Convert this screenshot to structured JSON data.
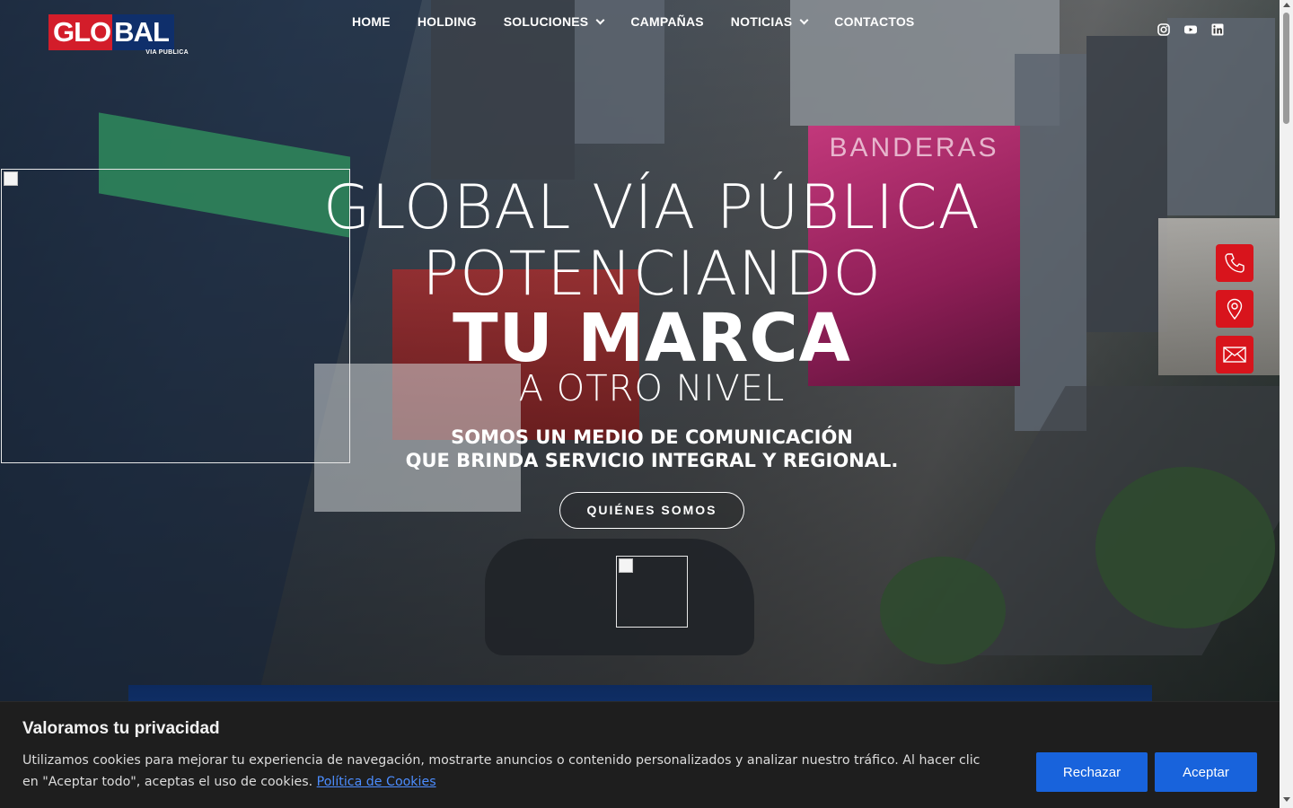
{
  "brand": {
    "logo_main_left": "GLO",
    "logo_main_right": "BAL",
    "logo_sub": "VIA PUBLICA",
    "colors": {
      "red": "#d31d2a",
      "navy": "#0f2f6b",
      "cookie_button": "#1863dc"
    }
  },
  "nav": {
    "items": [
      {
        "label": "HOME",
        "has_dropdown": false
      },
      {
        "label": "HOLDING",
        "has_dropdown": false
      },
      {
        "label": "SOLUCIONES",
        "has_dropdown": true
      },
      {
        "label": "CAMPAÑAS",
        "has_dropdown": false
      },
      {
        "label": "NOTICIAS",
        "has_dropdown": true
      },
      {
        "label": "CONTACTOS",
        "has_dropdown": false
      }
    ]
  },
  "social": {
    "icons": [
      "instagram-icon",
      "youtube-icon",
      "linkedin-icon"
    ]
  },
  "hero": {
    "line1": "GLOBAL VÍA PÚBLICA",
    "line2": "POTENCIANDO",
    "line3": "TU MARCA",
    "line4": "A OTRO NIVEL",
    "subtitle1": "SOMOS UN MEDIO DE COMUNICACIÓN",
    "subtitle2": "QUE BRINDA SERVICIO INTEGRAL Y REGIONAL.",
    "cta_label": "QUIÉNES SOMOS",
    "billboard_text": "BANDERAS"
  },
  "floating_contacts": {
    "icons": [
      "phone-icon",
      "map-pin-icon",
      "mail-icon"
    ]
  },
  "cookie_banner": {
    "title": "Valoramos tu privacidad",
    "text": "Utilizamos cookies para mejorar tu experiencia de navegación, mostrarte anuncios o contenido personalizados y analizar nuestro tráfico. Al hacer clic en \"Aceptar todo\", aceptas el uso de cookies.",
    "link_label": "Política de Cookies",
    "reject_label": "Rechazar",
    "accept_label": "Aceptar"
  }
}
